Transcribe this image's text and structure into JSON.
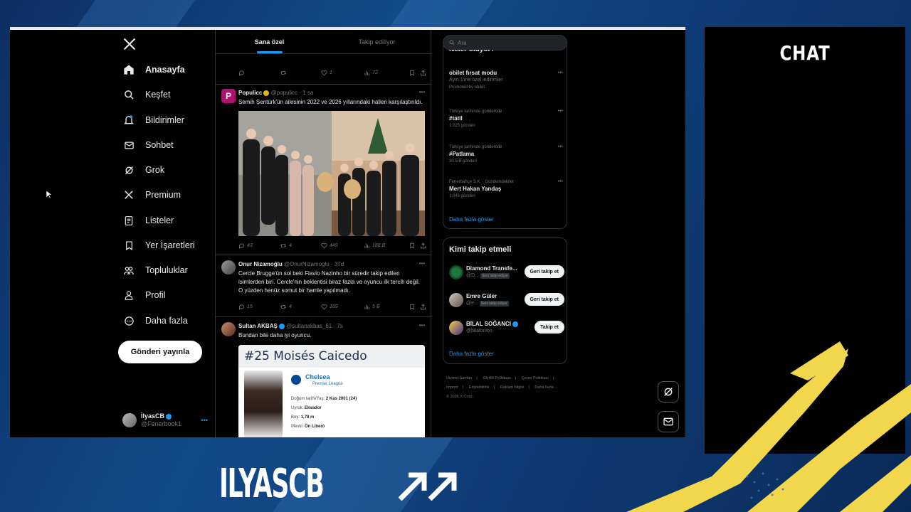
{
  "nav": {
    "items": [
      {
        "label": "Anasayfa",
        "icon": "home-icon",
        "active": true
      },
      {
        "label": "Keşfet",
        "icon": "search-icon"
      },
      {
        "label": "Bildirimler",
        "icon": "bell-icon"
      },
      {
        "label": "Sohbet",
        "icon": "mail-icon"
      },
      {
        "label": "Grok",
        "icon": "grok-icon"
      },
      {
        "label": "Premium",
        "icon": "x-icon"
      },
      {
        "label": "Listeler",
        "icon": "list-icon"
      },
      {
        "label": "Yer İşaretleri",
        "icon": "bookmark-icon"
      },
      {
        "label": "Topluluklar",
        "icon": "people-icon"
      },
      {
        "label": "Profil",
        "icon": "user-icon"
      },
      {
        "label": "Daha fazla",
        "icon": "more-circle-icon"
      }
    ],
    "post_button": "Gönderi yayınla",
    "profile": {
      "name": "İlyasCB",
      "handle": "@Fenerbook1"
    }
  },
  "feed": {
    "tabs": [
      "Sana özel",
      "Takip ediliyor"
    ],
    "top_actions": {
      "replies": "",
      "reposts": "",
      "likes": "1",
      "views": "73"
    },
    "tweets": [
      {
        "name": "Populicc",
        "handle": "@populicc",
        "time": "1 sa",
        "text": "Semih Şentürk'ün ailesinin 2022 ve 2026 yıllarındaki halleri karşılaştırıldı.",
        "actions": {
          "replies": "43",
          "reposts": "4",
          "likes": "449",
          "views": "188 B"
        }
      },
      {
        "name": "Onur Nizamoğlu",
        "handle": "@OnurNizamoglu",
        "time": "37d",
        "text": "Cercle Brugge'ün sol beki Flavio Nazinho bir süredir takip edilen isimlerden biri. Cercle'nin beklentisi biraz fazla ve oyuncu ilk tercih değil. O yüzden henüz somut bir hamle yapılmadı.",
        "actions": {
          "replies": "15",
          "reposts": "4",
          "likes": "159",
          "views": "5 B"
        }
      },
      {
        "name": "Sultan AKBAŞ",
        "handle": "@sultanakbas_61",
        "time": "7s",
        "text": "Bundan bile daha iyi oyuncu.",
        "card": {
          "title": "#25 Moisés Caicedo",
          "club": "Chelsea",
          "league": "Premier League",
          "rows": [
            {
              "k": "Doğum tarihi/Yaş:",
              "v": "2 Kas 2001 (24)"
            },
            {
              "k": "Uyruk:",
              "v": "Ekvador"
            },
            {
              "k": "Boy:",
              "v": "1,78 m"
            },
            {
              "k": "Mevki:",
              "v": "Ön Libero"
            }
          ]
        }
      }
    ]
  },
  "right": {
    "search_placeholder": "Ara",
    "trends_title": "Neler oluyor?",
    "trends": [
      {
        "cat": "",
        "title": "obilet fırsat modu",
        "sub": "Ayın 1'ine özel indirimler.",
        "extra": "Promoted by obilet"
      },
      {
        "cat": "Türkiye tarihinde gündemde",
        "title": "#tatil",
        "sub": "1.025 gönderi"
      },
      {
        "cat": "Türkiye tarihinde gündemde",
        "title": "#Patlama",
        "sub": "30,5 B gönderi"
      },
      {
        "cat": "Fenerbahçe S.K. · Gündemdekiler",
        "title": "Mert Hakan Yandaş",
        "sub": "1.045 gönderi"
      }
    ],
    "show_more": "Daha fazla göster",
    "who_title": "Kimi takip etmeli",
    "who": [
      {
        "name": "Diamond Transfe...",
        "handle": "@D...",
        "tag": "Seni takip ediyor",
        "button": "Geri takip et"
      },
      {
        "name": "Emre Güler",
        "handle": "@e...",
        "tag": "Seni takip ediyor",
        "button": "Geri takip et"
      },
      {
        "name": "BİLAL SOĞANCI",
        "handle": "@bilalonlon",
        "tag": "",
        "button": "Takip et"
      }
    ],
    "who_more": "Daha fazla göster",
    "footer": [
      "Hizmet Şartları",
      "Gizlilik Politikası",
      "Çerez Politikası",
      "Imprint",
      "Erişilebilirlik",
      "Reklam bilgisi",
      "Daha fazla ...",
      "© 2026 X Corp."
    ]
  },
  "overlay": {
    "chat_title": "CHAT",
    "brand": "ILYASCB"
  }
}
